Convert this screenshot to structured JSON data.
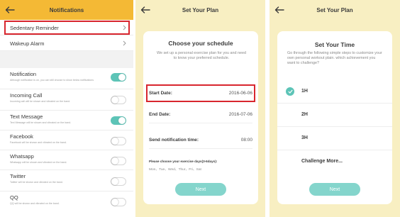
{
  "screen1": {
    "title": "Notifications",
    "menu": [
      {
        "label": "Sedentary Reminder"
      },
      {
        "label": "Wakeup Alarm"
      }
    ],
    "toggles": [
      {
        "label": "Notification",
        "desc": "Although notification is on, you can still choose to show below notifications",
        "on": true
      },
      {
        "label": "Incoming Call",
        "desc": "Incoming call will be shown and vibrated on the band.",
        "on": false
      },
      {
        "label": "Text Message",
        "desc": "Text Message will be shown and vibrated on the band.",
        "on": true
      },
      {
        "label": "Facebook",
        "desc": "Facebook will be shown and vibrated on the band.",
        "on": false
      },
      {
        "label": "Whatsapp",
        "desc": "Whatsapp will be shown and vibrated on the band.",
        "on": false
      },
      {
        "label": "Twitter",
        "desc": "Twitter will be shown and vibrated on the band.",
        "on": false
      },
      {
        "label": "QQ",
        "desc": "QQ will be shown and vibrated on the band.",
        "on": false
      }
    ]
  },
  "screen2": {
    "title": "Set Your Plan",
    "card_title": "Choose your schedule",
    "card_sub": "We set up a personal exercise plan for you and need to know your preferred schedule.",
    "start_label": "Start Date:",
    "start_value": "2016-06-06",
    "end_label": "End Date:",
    "end_value": "2016-07-06",
    "notify_label": "Send notification time:",
    "notify_value": "08:00",
    "days_title": "Please choose your exercise days(3-6days):",
    "days": "Mon、Tue、Wed、Thur、Fri、Sat",
    "next": "Next"
  },
  "screen3": {
    "title": "Set Your Plan",
    "card_title": "Set Your Time",
    "card_sub": "Go through the following simple steps to customize your own personal workout plain. which achievement you want to challenge?",
    "options": [
      {
        "label": "1H",
        "selected": true
      },
      {
        "label": "2H",
        "selected": false
      },
      {
        "label": "3H",
        "selected": false
      },
      {
        "label": "Challenge More...",
        "selected": false
      }
    ],
    "next": "Next"
  },
  "colors": {
    "header_orange": "#f4b935",
    "plan_bg": "#f8efc2",
    "accent_teal": "#5dc4b7",
    "highlight_red": "#d8262e"
  }
}
